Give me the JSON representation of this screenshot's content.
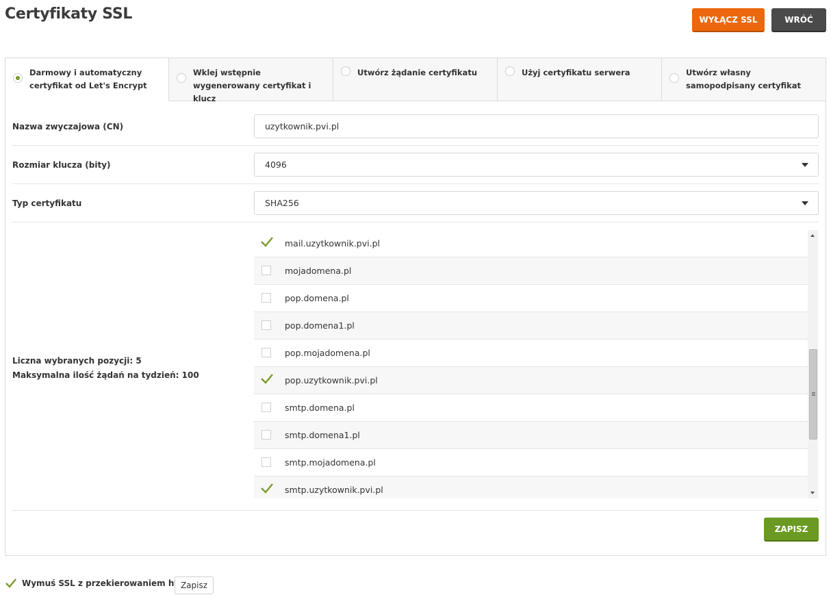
{
  "page": {
    "title": "Certyfikaty SSL"
  },
  "header_buttons": {
    "disable_ssl": "WYŁĄCZ SSL",
    "back": "WRÓĆ"
  },
  "tabs": [
    {
      "label": "Darmowy i automatyczny certyfikat od Let's Encrypt",
      "active": true
    },
    {
      "label": "Wklej wstępnie wygenerowany certyfikat i klucz",
      "active": false
    },
    {
      "label": "Utwórz żądanie certyfikatu",
      "active": false
    },
    {
      "label": "Użyj certyfikatu serwera",
      "active": false
    },
    {
      "label": "Utwórz własny samopodpisany certyfikat",
      "active": false
    }
  ],
  "form": {
    "cn_label": "Nazwa zwyczajowa (CN)",
    "cn_value": "uzytkownik.pvi.pl",
    "key_size_label": "Rozmiar klucza (bity)",
    "key_size_value": "4096",
    "cert_type_label": "Typ certyfikatu",
    "cert_type_value": "SHA256",
    "selected_count": "Liczna wybranych pozycji: 5",
    "max_requests": "Maksymalna ilość żądań na tydzień: 100",
    "save_label": "ZAPISZ"
  },
  "domains": [
    {
      "name": "mail.uzytkownik.pvi.pl",
      "checked": true
    },
    {
      "name": "mojadomena.pl",
      "checked": false
    },
    {
      "name": "pop.domena.pl",
      "checked": false
    },
    {
      "name": "pop.domena1.pl",
      "checked": false
    },
    {
      "name": "pop.mojadomena.pl",
      "checked": false
    },
    {
      "name": "pop.uzytkownik.pvi.pl",
      "checked": true
    },
    {
      "name": "smtp.domena.pl",
      "checked": false
    },
    {
      "name": "smtp.domena1.pl",
      "checked": false
    },
    {
      "name": "smtp.mojadomena.pl",
      "checked": false
    },
    {
      "name": "smtp.uzytkownik.pvi.pl",
      "checked": true
    }
  ],
  "footer": {
    "force_ssl_label": "Wymuś SSL z przekierowaniem https",
    "force_ssl_checked": true,
    "save_small": "Zapisz"
  },
  "colors": {
    "orange": "#ec670d",
    "dark": "#4a4a4a",
    "green": "#6b9a22",
    "check": "#7a9a2a"
  }
}
